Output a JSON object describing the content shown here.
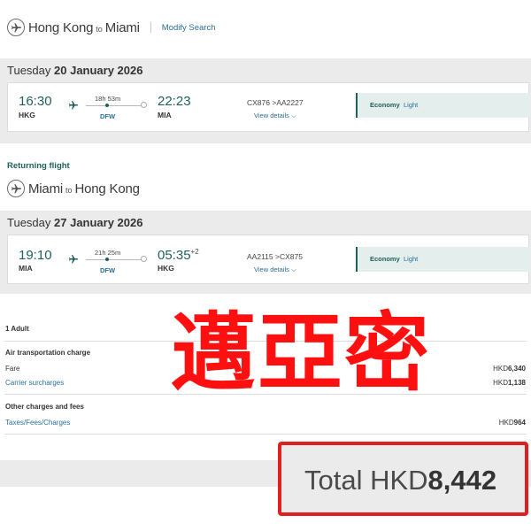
{
  "outbound": {
    "header": {
      "from": "Hong Kong",
      "to_word": "to",
      "to": "Miami",
      "modify_label": "Modify Search"
    },
    "date": {
      "weekday": "Tuesday",
      "date": "20 January 2026"
    },
    "flight": {
      "depart_time": "16:30",
      "depart_code": "HKG",
      "duration": "18h 53m",
      "stop_code": "DFW",
      "arrive_time": "22:23",
      "arrive_code": "MIA",
      "arrive_plus": "",
      "flight_numbers": "CX876 >AA2227",
      "view_details": "View details",
      "cabin": "Economy",
      "fare_type": "Light"
    }
  },
  "returning": {
    "label": "Returning flight",
    "header": {
      "from": "Miami",
      "to_word": "to",
      "to": "Hong Kong"
    },
    "date": {
      "weekday": "Tuesday",
      "date": "27 January 2026"
    },
    "flight": {
      "depart_time": "19:10",
      "depart_code": "MIA",
      "duration": "21h 25m",
      "stop_code": "DFW",
      "arrive_time": "05:35",
      "arrive_code": "HKG",
      "arrive_plus": "+2",
      "flight_numbers": "AA2115 >CX875",
      "view_details": "View details",
      "cabin": "Economy",
      "fare_type": "Light"
    }
  },
  "fare": {
    "passengers": "1 Adult",
    "air_heading": "Air transportation charge",
    "fare_label": "Fare",
    "fare_currency": "HKD",
    "fare_amount": "6,340",
    "carrier_label": "Carrier surcharges",
    "carrier_currency": "HKD",
    "carrier_amount": "1,138",
    "other_heading": "Other charges and fees",
    "taxes_label": "Taxes/Fees/Charges",
    "taxes_currency": "HKD",
    "taxes_amount": "964"
  },
  "total": {
    "label": "Total HKD",
    "amount": "8,442"
  },
  "overlay": {
    "text": "邁亞密",
    "color": "#ff1010"
  },
  "colors": {
    "accent": "#1f5f5b",
    "link": "#2a6f97",
    "highlight": "#e02020"
  }
}
